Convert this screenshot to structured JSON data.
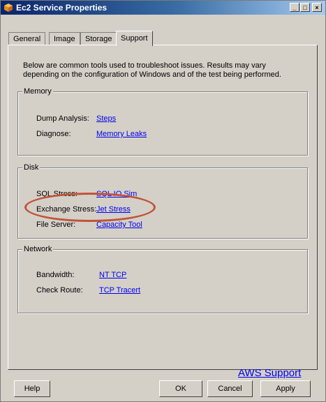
{
  "window": {
    "title": "Ec2 Service Properties",
    "controls": {
      "minimize": "_",
      "maximize": "□",
      "close": "×"
    }
  },
  "tabs": [
    {
      "label": "General"
    },
    {
      "label": "Image"
    },
    {
      "label": "Storage"
    },
    {
      "label": "Support",
      "active": true
    }
  ],
  "intro": "Below are common tools used to troubleshoot issues. Results may vary depending on the configuration of Windows and of the test being performed.",
  "groups": {
    "memory": {
      "title": "Memory",
      "rows": [
        {
          "label": "Dump Analysis:",
          "link": "Steps"
        },
        {
          "label": "Diagnose:",
          "link": "Memory Leaks"
        }
      ]
    },
    "disk": {
      "title": "Disk",
      "rows": [
        {
          "label": "SQL Stress:",
          "link": "SQL IO Sim"
        },
        {
          "label": "Exchange Stress:",
          "link": "Jet Stress"
        },
        {
          "label": "File Server:",
          "link": "Capacity Tool"
        }
      ]
    },
    "network": {
      "title": "Network",
      "rows": [
        {
          "label": "Bandwidth:",
          "link": "NT TCP"
        },
        {
          "label": "Check Route:",
          "link": "TCP Tracert"
        }
      ]
    }
  },
  "aws_support": "AWS Support",
  "buttons": {
    "help": "Help",
    "ok": "OK",
    "cancel": "Cancel",
    "apply": "Apply"
  },
  "colors": {
    "titlebar": "#0a246a",
    "link": "#0000ee",
    "highlight": "#c0543a",
    "face": "#d4d0c8"
  }
}
